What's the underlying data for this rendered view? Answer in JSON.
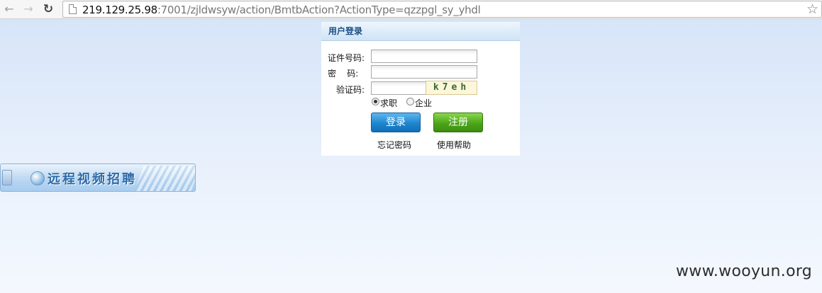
{
  "browser": {
    "url_host": "219.129.25.98",
    "url_rest": ":7001/zjldwsyw/action/BmtbAction?ActionType=qzzpgl_sy_yhdl",
    "back_icon": "←",
    "forward_icon": "→",
    "reload_icon": "↻",
    "bookmark_icon": "☆"
  },
  "login": {
    "title": "用户登录",
    "id_label": "证件号码:",
    "id_value": "",
    "password_label": "密    码:",
    "password_value": "",
    "captcha_label": "验证码:",
    "captcha_value": "",
    "captcha_image_text": "k7eh",
    "radio_options": [
      {
        "label": "求职",
        "checked": true
      },
      {
        "label": "企业",
        "checked": false
      }
    ],
    "login_button": "登录",
    "register_button": "注册",
    "forgot_password": "忘记密码",
    "help": "使用帮助"
  },
  "banner": {
    "text": "远程视频招聘"
  },
  "watermark": "www.wooyun.org"
}
